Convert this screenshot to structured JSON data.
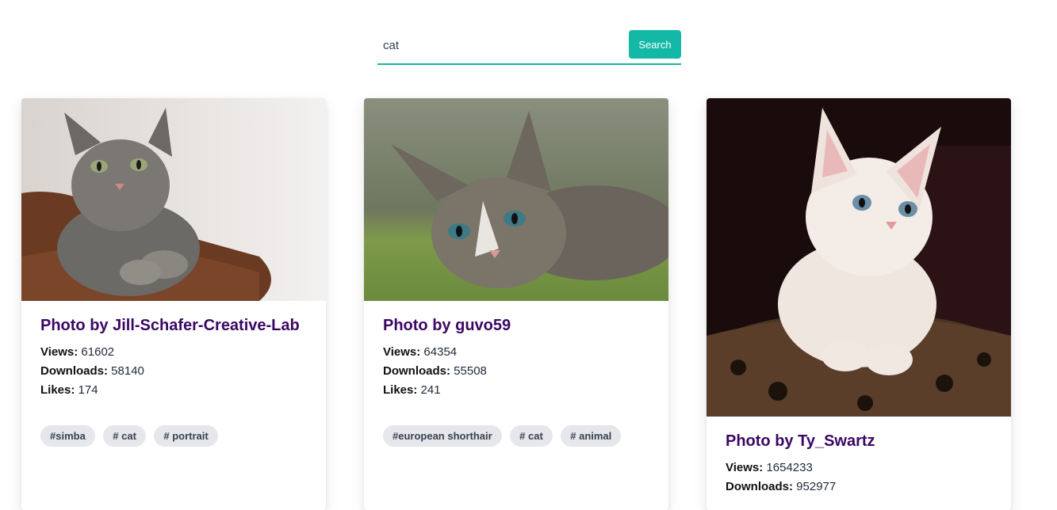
{
  "search": {
    "value": "cat",
    "button_label": "Search"
  },
  "colors": {
    "accent": "#14b8a6",
    "title": "#3b0764",
    "tag_bg": "#e5e7eb"
  },
  "cards": [
    {
      "title": "Photo by Jill-Schafer-Creative-Lab",
      "views_label": "Views:",
      "views": "61602",
      "downloads_label": "Downloads:",
      "downloads": "58140",
      "likes_label": "Likes:",
      "likes": "174",
      "tags": [
        "#simba",
        "# cat",
        "# portrait"
      ],
      "photo_subject": "tabby-cat-portrait"
    },
    {
      "title": "Photo by guvo59",
      "views_label": "Views:",
      "views": "64354",
      "downloads_label": "Downloads:",
      "downloads": "55508",
      "likes_label": "Likes:",
      "likes": "241",
      "tags": [
        "#european shorthair",
        "# cat",
        "# animal"
      ],
      "photo_subject": "tabby-kitten-lying"
    },
    {
      "title": "Photo by Ty_Swartz",
      "views_label": "Views:",
      "views": "1654233",
      "downloads_label": "Downloads:",
      "downloads": "952977",
      "photo_subject": "white-kitten"
    }
  ]
}
